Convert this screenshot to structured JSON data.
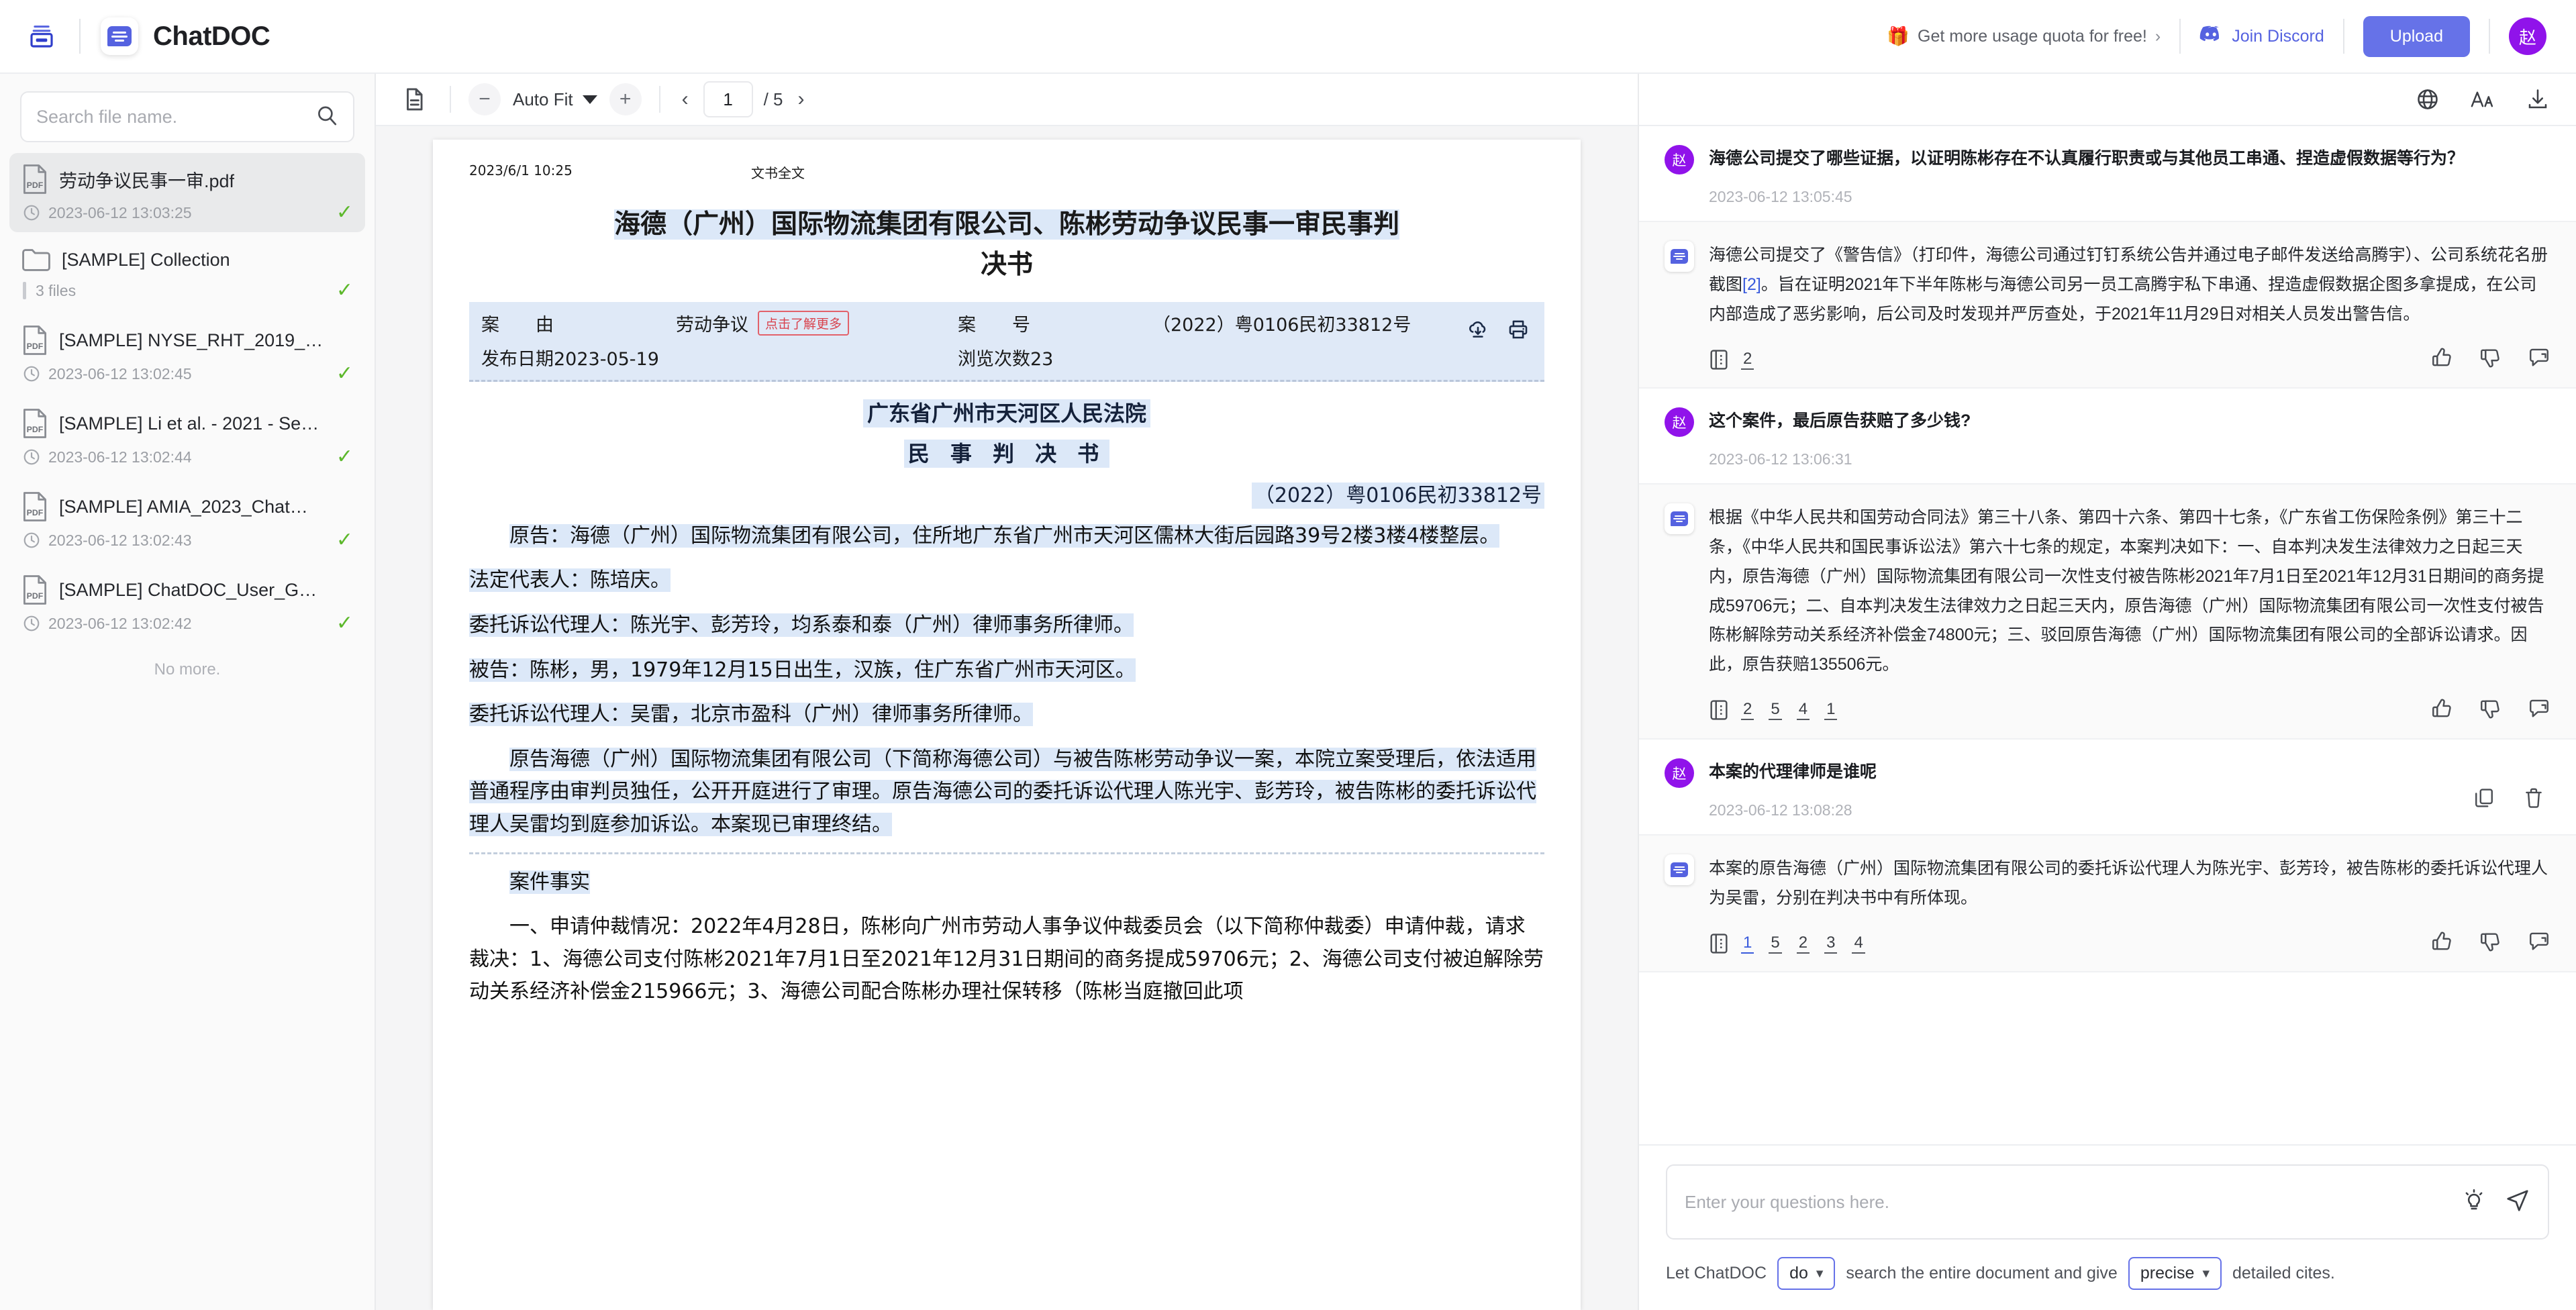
{
  "app": {
    "brand": "ChatDOC",
    "quota_label": "Get more usage quota for free!",
    "quota_chevron": "›",
    "gift_icon": "gift-icon",
    "discord_label": "Join Discord",
    "upload_label": "Upload",
    "avatar_initial": "赵"
  },
  "sidebar": {
    "search": {
      "value": "",
      "placeholder": "Search file name."
    },
    "no_more": "No more.",
    "files": [
      {
        "type": "pdf",
        "name": "劳动争议民事一审.pdf",
        "date": "2023-06-12 13:03:25",
        "selected": true,
        "status": "✓"
      },
      {
        "type": "folder",
        "name": "[SAMPLE] Collection",
        "count": "3 files",
        "selected": false,
        "status": "✓"
      },
      {
        "type": "pdf",
        "name": "[SAMPLE] NYSE_RHT_2019_…",
        "date": "2023-06-12 13:02:45",
        "selected": false,
        "status": "✓"
      },
      {
        "type": "pdf",
        "name": "[SAMPLE] Li et al. - 2021 - Se…",
        "date": "2023-06-12 13:02:44",
        "selected": false,
        "status": "✓"
      },
      {
        "type": "pdf",
        "name": "[SAMPLE] AMIA_2023_Chat…",
        "date": "2023-06-12 13:02:43",
        "selected": false,
        "status": "✓"
      },
      {
        "type": "pdf",
        "name": "[SAMPLE] ChatDOC_User_G…",
        "date": "2023-06-12 13:02:42",
        "selected": false,
        "status": "✓"
      }
    ]
  },
  "doc_toolbar": {
    "zoom_out": "−",
    "zoom_in": "+",
    "fit_label": "Auto Fit",
    "prev": "‹",
    "next": "›",
    "page_current": "1",
    "page_total": "/ 5"
  },
  "document": {
    "header_date": "2023/6/1 10:25",
    "header_center": "文书全文",
    "title": "海德（广州）国际物流集团有限公司、陈彬劳动争议民事一审民事判",
    "title2": "决书",
    "meta_label_1": "案　　由",
    "meta_value_1": "劳动争议",
    "meta_tag": "点击了解更多",
    "meta_label_2": "案　　号",
    "meta_value_2": "（2022）粤0106民初33812号",
    "meta_label_3": "发布日期2023-05-19",
    "meta_value_3": "浏览次数23",
    "court": "广东省广州市天河区人民法院",
    "judgment_title": "民 事 判 决 书",
    "case_number": "（2022）粤0106民初33812号",
    "paragraphs": [
      "原告：海德（广州）国际物流集团有限公司，住所地广东省广州市天河区儒林大街后园路39号2楼3楼4楼整层。",
      "法定代表人：陈培庆。",
      "委托诉讼代理人：陈光宇、彭芳玲，均系泰和泰（广州）律师事务所律师。",
      "被告：陈彬，男，1979年12月15日出生，汉族，住广东省广州市天河区。",
      "委托诉讼代理人：吴雷，北京市盈科（广州）律师事务所律师。",
      "原告海德（广州）国际物流集团有限公司（下简称海德公司）与被告陈彬劳动争议一案，本院立案受理后，依法适用普通程序由审判员独任，公开开庭进行了审理。原告海德公司的委托诉讼代理人陈光宇、彭芳玲，被告陈彬的委托诉讼代理人吴雷均到庭参加诉讼。本案现已审理终结。",
      "案件事实",
      "一、申请仲裁情况：2022年4月28日，陈彬向广州市劳动人事争议仲裁委员会（以下简称仲裁委）申请仲裁，请求裁决：1、海德公司支付陈彬2021年7月1日至2021年12月31日期间的商务提成59706元；2、海德公司支付被迫解除劳动关系经济补偿金215966元；3、海德公司配合陈彬办理社保转移（陈彬当庭撤回此项"
    ]
  },
  "chat": {
    "toolbar": {
      "translate": "globe-icon",
      "font": "font-size-icon",
      "download": "download-icon"
    },
    "messages": [
      {
        "role": "user",
        "avatar": "赵",
        "text": "海德公司提交了哪些证据，以证明陈彬存在不认真履行职责或与其他员工串通、捏造虚假数据等行为？",
        "time": "2023-06-12 13:05:45",
        "show_row_actions": false
      },
      {
        "role": "ai",
        "text": "海德公司提交了《警告信》（打印件，海德公司通过钉钉系统公告并通过电子邮件发送给高腾宇）、公司系统花名册截图",
        "cite": "[2]",
        "text2": "。旨在证明2021年下半年陈彬与海德公司另一员工高腾宇私下串通、捏造虚假数据企图多拿提成，在公司内部造成了恶劣影响，后公司及时发现并严厉查处，于2021年11月29日对相关人员发出警告信。",
        "refs": [
          "2"
        ],
        "active_ref": null
      },
      {
        "role": "user",
        "avatar": "赵",
        "text": "这个案件，最后原告获赔了多少钱?",
        "time": "2023-06-12 13:06:31",
        "show_row_actions": false
      },
      {
        "role": "ai",
        "text": "根据《中华人民共和国劳动合同法》第三十八条、第四十六条、第四十七条，《广东省工伤保险条例》第三十二条，《中华人民共和国民事诉讼法》第六十七条的规定，本案判决如下：一、自本判决发生法律效力之日起三天内，原告海德（广州）国际物流集团有限公司一次性支付被告陈彬2021年7月1日至2021年12月31日期间的商务提成59706元；二、自本判决发生法律效力之日起三天内，原告海德（广州）国际物流集团有限公司一次性支付被告陈彬解除劳动关系经济补偿金74800元；三、驳回原告海德（广州）国际物流集团有限公司的全部诉讼请求。因此，原告获赔135506元。",
        "refs": [
          "2",
          "5",
          "4",
          "1"
        ],
        "active_ref": null
      },
      {
        "role": "user",
        "avatar": "赵",
        "text": "本案的代理律师是谁呢",
        "time": "2023-06-12 13:08:28",
        "show_row_actions": true
      },
      {
        "role": "ai",
        "text": "本案的原告海德（广州）国际物流集团有限公司的委托诉讼代理人为陈光宇、彭芳玲，被告陈彬的委托诉讼代理人为吴雷，分别在判决书中有所体现。",
        "refs": [
          "1",
          "5",
          "2",
          "3",
          "4"
        ],
        "active_ref": "1"
      }
    ],
    "composer": {
      "placeholder": "Enter your questions here.",
      "value": "",
      "opt_prefix": "Let ChatDOC",
      "mode_value": "do",
      "opt_middle": "search the entire document and give",
      "precision_value": "precise",
      "opt_suffix": "detailed cites."
    }
  },
  "colors": {
    "accent": "#6672e8",
    "avatar": "#9013ea",
    "highlight": "#dce8f8",
    "check": "#5cb82b",
    "cite": "#3a5bdc"
  }
}
